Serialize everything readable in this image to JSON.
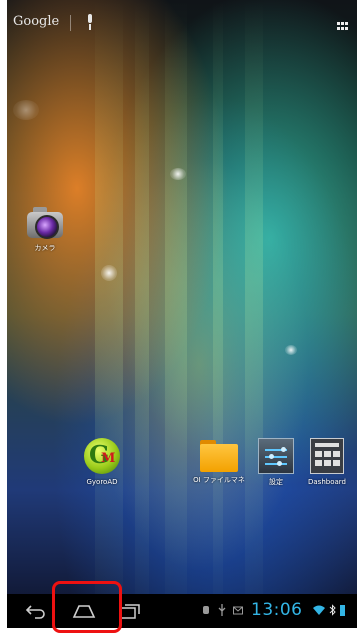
{
  "search": {
    "logo_text": "Google"
  },
  "apps": {
    "camera": {
      "label": "カメラ"
    },
    "gyoroad": {
      "label": "GyoroAD",
      "icon_text_g": "G",
      "icon_text_m": "M"
    },
    "oi_file_manager": {
      "label": "OI ファイルマネ"
    },
    "settings": {
      "label": "設定"
    },
    "dashboard": {
      "label": "Dashboard"
    }
  },
  "status": {
    "time": "13:06",
    "clock_color": "#33b5e5"
  },
  "icons": [
    "microphone-icon",
    "all-apps-grid-icon",
    "camera-icon",
    "folder-icon",
    "settings-icon",
    "dashboard-icon",
    "back-icon",
    "home-icon",
    "recent-apps-icon",
    "usb-debug-icon",
    "usb-icon",
    "gmail-icon",
    "wifi-icon",
    "bluetooth-icon",
    "battery-icon"
  ],
  "highlight": {
    "target": "home-button",
    "color": "#ee1111"
  }
}
